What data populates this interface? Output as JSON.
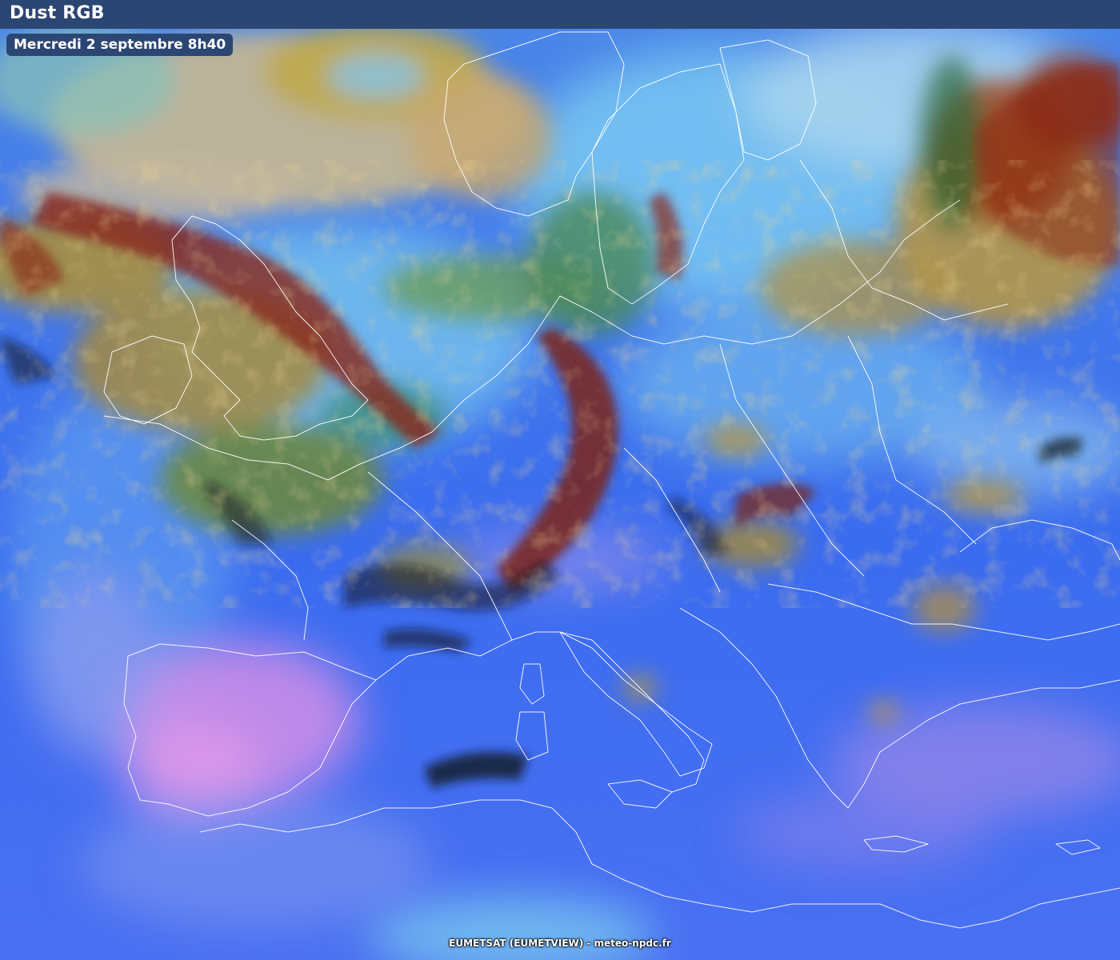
{
  "header": {
    "title": "Dust RGB"
  },
  "image": {
    "date_label": "Mercredi 2 septembre 8h40"
  },
  "footer": {
    "credit": "EUMETSAT (EUMETVIEW) - meteo-npdc.fr"
  },
  "colors": {
    "header_bg": "#2c4674",
    "sea_blue": "#3a6cf0",
    "dust_pink": "#d090e8",
    "thick_cloud_red": "#8a2a18",
    "mid_cloud_ochre": "#b09040",
    "cirrus_black": "#101820",
    "high_cloud_cyan": "#80c8f0",
    "coastline": "#ffffff"
  }
}
